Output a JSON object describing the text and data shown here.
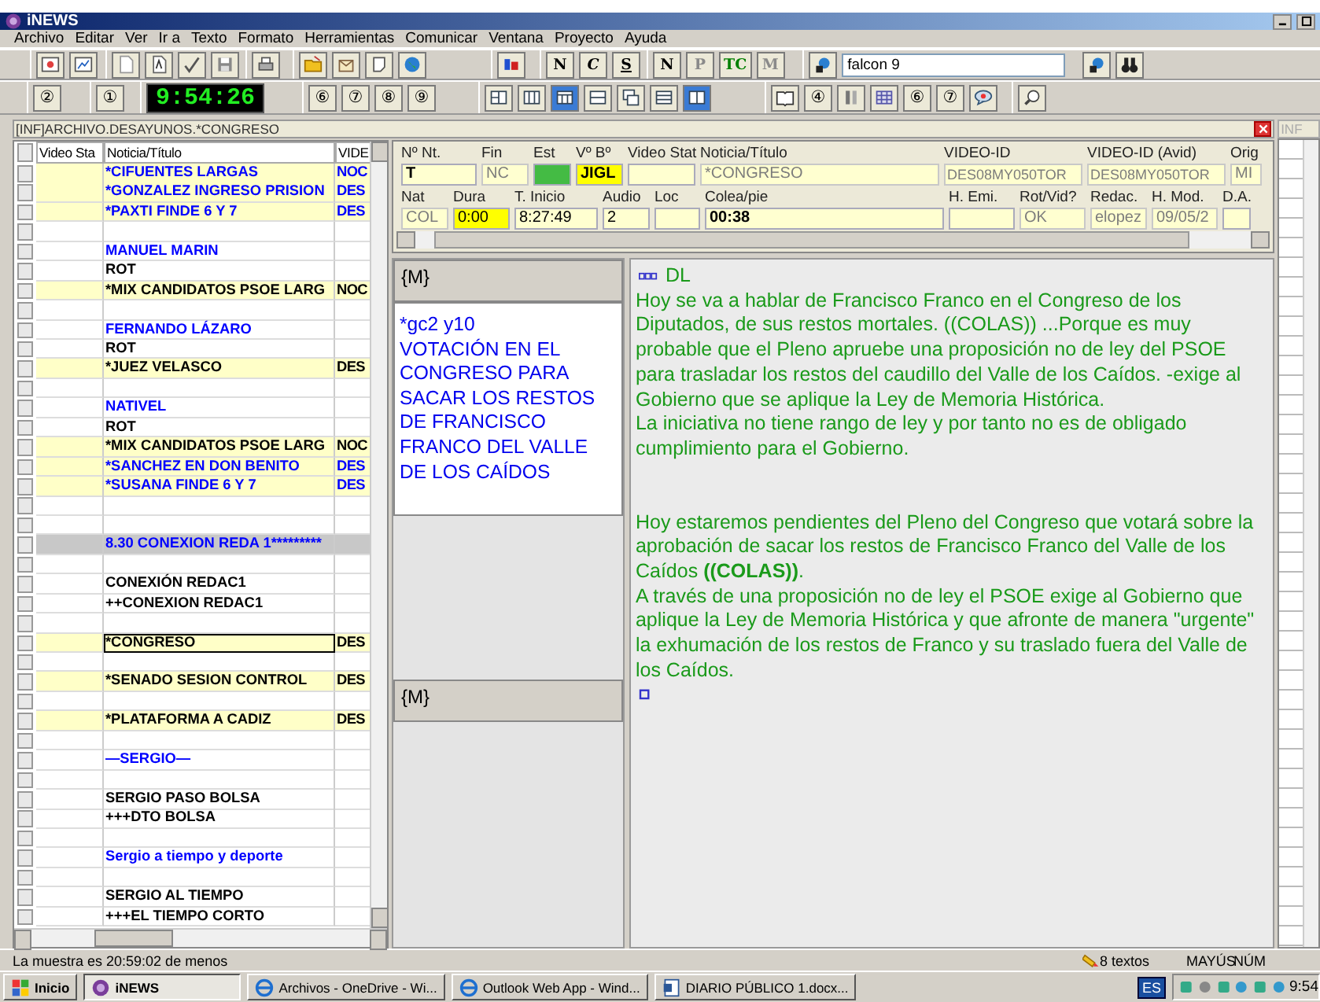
{
  "app": {
    "title": "iNEWS"
  },
  "menu": [
    "Archivo",
    "Editar",
    "Ver",
    "Ir a",
    "Texto",
    "Formato",
    "Herramientas",
    "Comunicar",
    "Ventana",
    "Proyecto",
    "Ayuda"
  ],
  "toolbar_1": [
    [
      {
        "kind": "icon"
      },
      {
        "kind": "icon"
      }
    ],
    [
      {
        "kind": "icon"
      },
      {
        "kind": "icon"
      },
      {
        "kind": "icon"
      },
      {
        "kind": "icon"
      }
    ],
    [
      {
        "kind": "icon"
      }
    ],
    [
      {
        "kind": "icon"
      },
      {
        "kind": "icon"
      },
      {
        "kind": "icon"
      },
      {
        "kind": "icon"
      }
    ],
    [
      {
        "kind": "icon"
      }
    ],
    [
      {
        "kind": "text",
        "label": "N",
        "color": "#000000"
      },
      {
        "kind": "text",
        "label": "C",
        "color": "#000000"
      },
      {
        "kind": "text",
        "label": "S",
        "color": "#000000"
      }
    ],
    [
      {
        "kind": "text",
        "label": "N",
        "color": "#000000"
      },
      {
        "kind": "text",
        "label": "P",
        "color": "#8a8a8a"
      },
      {
        "kind": "text",
        "label": "TC",
        "color": "#008000"
      },
      {
        "kind": "text",
        "label": "M",
        "color": "#8a8a8a"
      }
    ],
    [
      {
        "kind": "icon"
      },
      {
        "kind": "field",
        "value": "falcon 9"
      },
      {
        "kind": "icon"
      },
      {
        "kind": "icon"
      }
    ]
  ],
  "toolbar_2": [
    [
      {
        "kind": "text",
        "label": "②",
        "color": "#000000"
      }
    ],
    [
      {
        "kind": "text",
        "label": "①",
        "color": "#000000"
      }
    ],
    [
      {
        "kind": "clock",
        "label": "9:54:26"
      }
    ],
    [
      {
        "kind": "text",
        "label": "⑥",
        "color": "#000000"
      },
      {
        "kind": "text",
        "label": "⑦",
        "color": "#000000"
      },
      {
        "kind": "text",
        "label": "⑧",
        "color": "#000000"
      },
      {
        "kind": "text",
        "label": "⑨",
        "color": "#000000"
      }
    ],
    [
      {
        "kind": "icon",
        "selected": false
      },
      {
        "kind": "icon",
        "selected": false
      },
      {
        "kind": "icon",
        "selected": true
      },
      {
        "kind": "icon",
        "selected": false
      },
      {
        "kind": "icon",
        "selected": false
      },
      {
        "kind": "icon",
        "selected": false
      },
      {
        "kind": "icon",
        "selected": true
      }
    ],
    [
      {
        "kind": "icon"
      },
      {
        "kind": "text",
        "label": "④",
        "color": "#000000"
      },
      {
        "kind": "icon"
      },
      {
        "kind": "icon"
      },
      {
        "kind": "text",
        "label": "⑥",
        "color": "#000000"
      },
      {
        "kind": "text",
        "label": "⑦",
        "color": "#000000"
      },
      {
        "kind": "icon"
      }
    ],
    [
      {
        "kind": "icon"
      }
    ]
  ],
  "document": {
    "title": "[INF]ARCHIVO.DESAYUNOS.*CONGRESO",
    "columns": [
      "Video Sta",
      "Noticia/Título",
      "VIDE"
    ],
    "rows": [
      {
        "kind": "story",
        "title": "*CIFUENTES LARGAS",
        "video_id": "NOC",
        "color": "#0000ff",
        "highlighted": true,
        "selected": false
      },
      {
        "kind": "story",
        "title": "*GONZALEZ INGRESO PRISION",
        "video_id": "DES",
        "color": "#0000ff",
        "highlighted": true,
        "selected": false
      },
      {
        "kind": "story",
        "title": "*PAXTI FINDE 6 Y 7",
        "video_id": "DES",
        "color": "#0000ff",
        "highlighted": true,
        "selected": false
      },
      {
        "kind": "blank",
        "selected": false
      },
      {
        "kind": "story",
        "title": "MANUEL MARIN",
        "color": "#0000ff",
        "highlighted": false,
        "selected": false
      },
      {
        "kind": "story",
        "title": "ROT",
        "color": "#000000",
        "highlighted": false,
        "selected": false
      },
      {
        "kind": "story",
        "title": "*MIX CANDIDATOS PSOE LARG",
        "video_id": "NOC",
        "color": "#000000",
        "highlighted": true,
        "selected": false
      },
      {
        "kind": "blank",
        "selected": false
      },
      {
        "kind": "story",
        "title": "FERNANDO LÁZARO",
        "color": "#0000ff",
        "highlighted": false,
        "selected": false
      },
      {
        "kind": "story",
        "title": "ROT",
        "color": "#000000",
        "highlighted": false,
        "selected": false
      },
      {
        "kind": "story",
        "title": "*JUEZ VELASCO",
        "video_id": "DES",
        "color": "#000000",
        "highlighted": true,
        "selected": false
      },
      {
        "kind": "blank",
        "selected": false
      },
      {
        "kind": "story",
        "title": "NATIVEL",
        "color": "#0000ff",
        "highlighted": false,
        "selected": false
      },
      {
        "kind": "story",
        "title": "ROT",
        "color": "#000000",
        "highlighted": false,
        "selected": false
      },
      {
        "kind": "story",
        "title": "*MIX CANDIDATOS PSOE LARG",
        "video_id": "NOC",
        "color": "#000000",
        "highlighted": true,
        "selected": false
      },
      {
        "kind": "story",
        "title": "*SANCHEZ EN DON BENITO",
        "video_id": "DES",
        "color": "#0000ff",
        "highlighted": true,
        "selected": false
      },
      {
        "kind": "story",
        "title": "*SUSANA FINDE 6 Y 7",
        "video_id": "DES",
        "color": "#0000ff",
        "highlighted": true,
        "selected": false
      },
      {
        "kind": "blank",
        "selected": false
      },
      {
        "kind": "blank",
        "selected": false
      },
      {
        "kind": "section",
        "title": "8.30 CONEXION REDA 1*********",
        "color": "#0000ff",
        "selected": false
      },
      {
        "kind": "blank",
        "selected": false
      },
      {
        "kind": "story",
        "title": "CONEXIÓN REDAC1",
        "color": "#000000",
        "highlighted": false,
        "selected": false
      },
      {
        "kind": "story",
        "title": "++CONEXION REDAC1",
        "color": "#000000",
        "highlighted": false,
        "selected": false
      },
      {
        "kind": "blank",
        "selected": false
      },
      {
        "kind": "story",
        "title": "*CONGRESO",
        "video_id": "DES",
        "color": "#000000",
        "highlighted": true,
        "selected": true
      },
      {
        "kind": "blank",
        "selected": false
      },
      {
        "kind": "story",
        "title": "*SENADO SESION CONTROL",
        "video_id": "DES",
        "color": "#000000",
        "highlighted": true,
        "selected": false
      },
      {
        "kind": "blank",
        "selected": false
      },
      {
        "kind": "story",
        "title": "*PLATAFORMA A CADIZ",
        "video_id": "DES",
        "color": "#000000",
        "highlighted": true,
        "selected": false
      },
      {
        "kind": "blank",
        "selected": false
      },
      {
        "kind": "story",
        "title": "—SERGIO—",
        "color": "#0000ff",
        "highlighted": false,
        "selected": false
      },
      {
        "kind": "blank",
        "selected": false
      },
      {
        "kind": "story",
        "title": "SERGIO PASO BOLSA",
        "color": "#000000",
        "highlighted": false,
        "selected": false
      },
      {
        "kind": "story",
        "title": "+++DTO BOLSA",
        "color": "#000000",
        "highlighted": false,
        "selected": false
      },
      {
        "kind": "blank",
        "selected": false
      },
      {
        "kind": "story",
        "title": "Sergio a tiempo y deporte",
        "color": "#0000ff",
        "highlighted": false,
        "selected": false
      },
      {
        "kind": "blank",
        "selected": false
      },
      {
        "kind": "story",
        "title": "SERGIO AL TIEMPO",
        "color": "#000000",
        "highlighted": false,
        "selected": false
      },
      {
        "kind": "story",
        "title": "+++EL TIEMPO CORTO",
        "color": "#000000",
        "highlighted": false,
        "selected": false
      }
    ]
  },
  "form": {
    "top_fields": [
      {
        "label": "Nº Nt.",
        "value": "T",
        "bold": true
      },
      {
        "label": "Fin",
        "value": "NC",
        "disabled": true
      },
      {
        "label": "Est",
        "color": "#44bb44"
      },
      {
        "label": "Vº Bº",
        "value": "JIGL",
        "bold": true,
        "color": "#ffff00"
      },
      {
        "label": "Video Stat"
      },
      {
        "label": "Noticia/Título",
        "value": "*CONGRESO",
        "disabled": true
      },
      {
        "label": "VIDEO-ID",
        "value": "DES08MY050TOR",
        "disabled": true
      },
      {
        "label": "VIDEO-ID (Avid)",
        "value": "DES08MY050TOR",
        "disabled": true
      },
      {
        "label": "Orig",
        "value": "MI",
        "disabled": true
      }
    ],
    "bottom_fields": [
      {
        "label": "Nat",
        "value": "COL",
        "disabled": true
      },
      {
        "label": "Dura",
        "value": "0:00",
        "color": "#ffff00"
      },
      {
        "label": "T. Inicio",
        "value": "8:27:49"
      },
      {
        "label": "Audio",
        "value": "2"
      },
      {
        "label": "Loc"
      },
      {
        "label": "Colea/pie",
        "value": "00:38",
        "bold": true
      },
      {
        "label": "H. Emi."
      },
      {
        "label": "Rot/Vid?",
        "value": "OK",
        "disabled": true
      },
      {
        "label": "Redac.",
        "value": "elopez",
        "disabled": true
      },
      {
        "label": "H. Mod.",
        "value": "09/05/2",
        "disabled": true
      },
      {
        "label": "D.A."
      }
    ]
  },
  "story_panel": {
    "top_header": "{M}",
    "slug": "*gc2 y10",
    "headline": "VOTACIÓN EN EL CONGRESO PARA SACAR LOS RESTOS DE FRANCISCO FRANCO DEL VALLE DE LOS CAÍDOS",
    "bottom_header": "{M}"
  },
  "script_panel": {
    "header": "DL",
    "blocks": [
      [
        "Hoy se va a hablar de Francisco Franco en el Congreso de los Diputados, de sus restos mortales. ((COLAS)) ...Porque es muy probable que el Pleno apruebe una proposición no de ley del PSOE para trasladar los restos del caudillo del Valle de los Caídos. -exige al Gobierno que se aplique la Ley de Memoria Histórica.",
        "La iniciativa no tiene rango de ley y por tanto no es de obligado cumplimiento para el Gobierno."
      ],
      [
        "Hoy estaremos pendientes del Pleno del Congreso que votará sobre la aprobación de sacar los restos de Francisco Franco del Valle de los Caídos **((COLAS))**.",
        "A través de una proposición no de ley el PSOE exige al Gobierno que aplique la Ley de Memoria Histórica y que afronte de manera \"urgente\" la exhumación de los restos de Franco y su traslado fuera del Valle de los Caídos."
      ]
    ]
  },
  "side_window": {
    "title": "INF"
  },
  "status_bar": {
    "message": "La muestra es 20:59:02 de menos",
    "count": "8 textos",
    "caps": "MAYÚS",
    "num": "NÚM"
  },
  "taskbar": {
    "start": "Inicio",
    "tasks": [
      {
        "label": "iNEWS",
        "selected": true
      },
      {
        "label": "Archivos - OneDrive - Wi...",
        "selected": false
      },
      {
        "label": "Outlook Web App - Wind...",
        "selected": false
      },
      {
        "label": "DIARIO PÚBLICO 1.docx...",
        "selected": false
      }
    ],
    "language": "ES",
    "clock": "9:54"
  }
}
